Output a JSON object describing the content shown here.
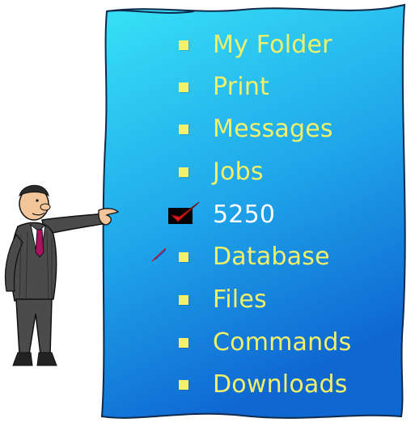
{
  "colors": {
    "panel_top": "#35dff5",
    "panel_bottom": "#106fd6",
    "panel_border": "#0f2a4a",
    "label": "#f0f06a",
    "label_current": "#ffffff",
    "bullet": "#f5f06a",
    "check_box": "#000000",
    "check_mark": "#e01515",
    "suit": "#4b4b4b",
    "skin": "#f2c69a",
    "tie": "#b01060"
  },
  "menu": {
    "items": [
      {
        "label": "My Folder",
        "icon": "square-bullet"
      },
      {
        "label": "Print",
        "icon": "square-bullet"
      },
      {
        "label": "Messages",
        "icon": "square-bullet"
      },
      {
        "label": "Jobs",
        "icon": "square-bullet"
      },
      {
        "label": "5250",
        "icon": "checkmark",
        "selected": true
      },
      {
        "label": "Database",
        "icon": "square-bullet"
      },
      {
        "label": "Files",
        "icon": "square-bullet"
      },
      {
        "label": "Commands",
        "icon": "square-bullet"
      },
      {
        "label": "Downloads",
        "icon": "square-bullet"
      }
    ]
  },
  "figure": {
    "icon": "businessman-pointing"
  },
  "cursor": {
    "icon": "pen-cursor"
  }
}
